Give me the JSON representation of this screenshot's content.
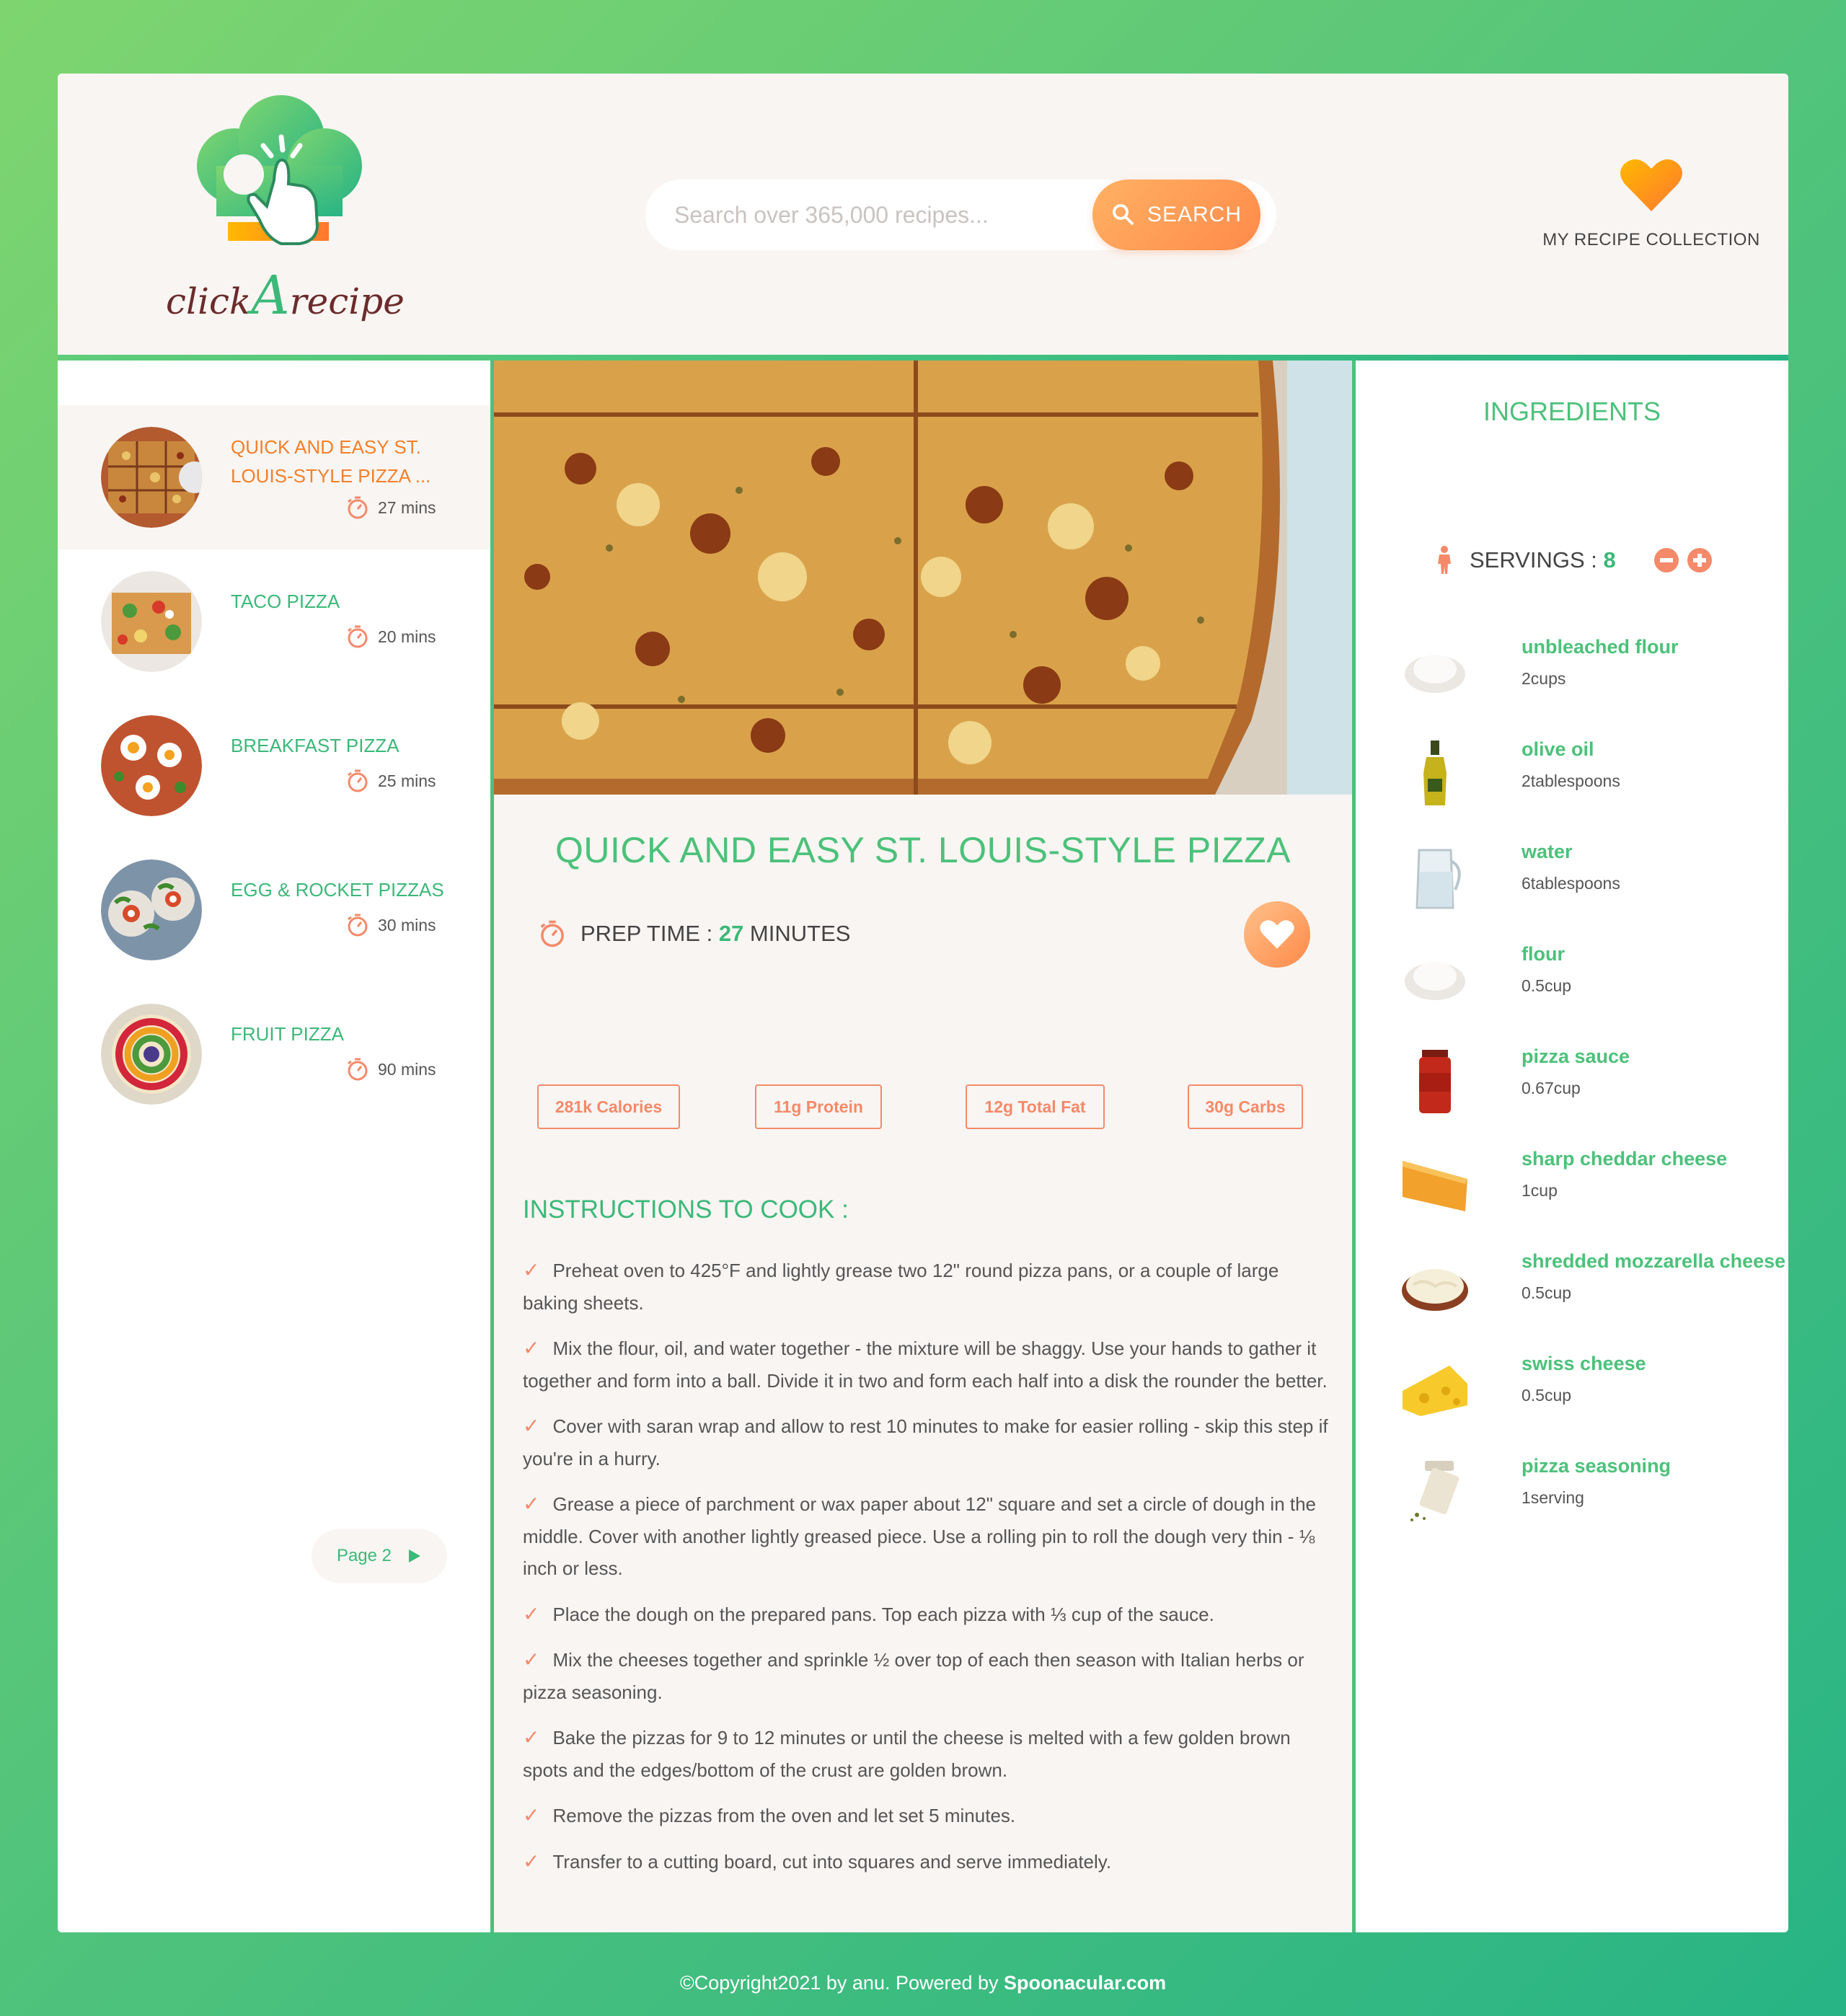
{
  "brand": {
    "logo_text_a": "click",
    "logo_text_b": "A",
    "logo_text_c": "recipe"
  },
  "search": {
    "placeholder": "Search over 365,000 recipes...",
    "button_label": "SEARCH"
  },
  "collection": {
    "label": "MY RECIPE COLLECTION"
  },
  "results": [
    {
      "title": "QUICK AND EASY ST. LOUIS-STYLE PIZZA ...",
      "time": "27 mins",
      "active": true
    },
    {
      "title": "TACO PIZZA",
      "time": "20 mins"
    },
    {
      "title": "BREAKFAST PIZZA",
      "time": "25 mins"
    },
    {
      "title": "EGG & ROCKET PIZZAS",
      "time": "30 mins"
    },
    {
      "title": "FRUIT PIZZA",
      "time": "90 mins"
    }
  ],
  "pagination": {
    "next_label": "Page 2"
  },
  "recipe": {
    "title": "QUICK AND EASY ST. LOUIS-STYLE PIZZA",
    "prep_label": "PREP TIME :",
    "prep_minutes": "27",
    "prep_unit": "MINUTES",
    "nutrition": [
      "281k Calories",
      "11g Protein",
      "12g Total Fat",
      "30g Carbs"
    ],
    "instructions_title": "INSTRUCTIONS TO COOK :",
    "steps": [
      "Preheat oven to 425°F and lightly grease two 12\" round pizza pans, or a couple of large baking sheets.",
      "Mix the flour, oil, and water together - the mixture will be shaggy. Use your hands to gather it together and form into a ball. Divide it in two and form each half into a disk the rounder the better.",
      "Cover with saran wrap and allow to rest 10 minutes to make for easier rolling - skip this step if you're in a hurry.",
      "Grease a piece of parchment or wax paper about 12\" square and set a circle of dough in the middle. Cover with another lightly greased piece. Use a rolling pin to roll the dough very thin - ⅛ inch or less.",
      "Place the dough on the prepared pans. Top each pizza with ⅓ cup of the sauce.",
      "Mix the cheeses together and sprinkle ½ over top of each then season with Italian herbs or pizza seasoning.",
      "Bake the pizzas for 9 to 12 minutes or until the cheese is melted with a few golden brown spots and the edges/bottom of the crust are golden brown.",
      "Remove the pizzas from the oven and let set 5 minutes.",
      "Transfer to a cutting board, cut into squares and serve immediately."
    ]
  },
  "ingredients": {
    "title": "INGREDIENTS",
    "servings_label": "SERVINGS :",
    "servings": "8",
    "items": [
      {
        "name": "unbleached flour",
        "amount": "2cups"
      },
      {
        "name": "olive oil",
        "amount": "2tablespoons"
      },
      {
        "name": "water",
        "amount": "6tablespoons"
      },
      {
        "name": "flour",
        "amount": "0.5cup"
      },
      {
        "name": "pizza sauce",
        "amount": "0.67cup"
      },
      {
        "name": "sharp cheddar cheese",
        "amount": "1cup"
      },
      {
        "name": "shredded mozzarella cheese",
        "amount": "0.5cup"
      },
      {
        "name": "swiss cheese",
        "amount": "0.5cup"
      },
      {
        "name": "pizza seasoning",
        "amount": "1serving"
      }
    ]
  },
  "footer": {
    "text": "©Copyright2021 by anu. Powered by ",
    "link": "Spoonacular.com"
  },
  "colors": {
    "green": "#4cc17a",
    "orange": "#f5802a",
    "salmon": "#f48a6a",
    "bg": "#f9f5f3"
  }
}
